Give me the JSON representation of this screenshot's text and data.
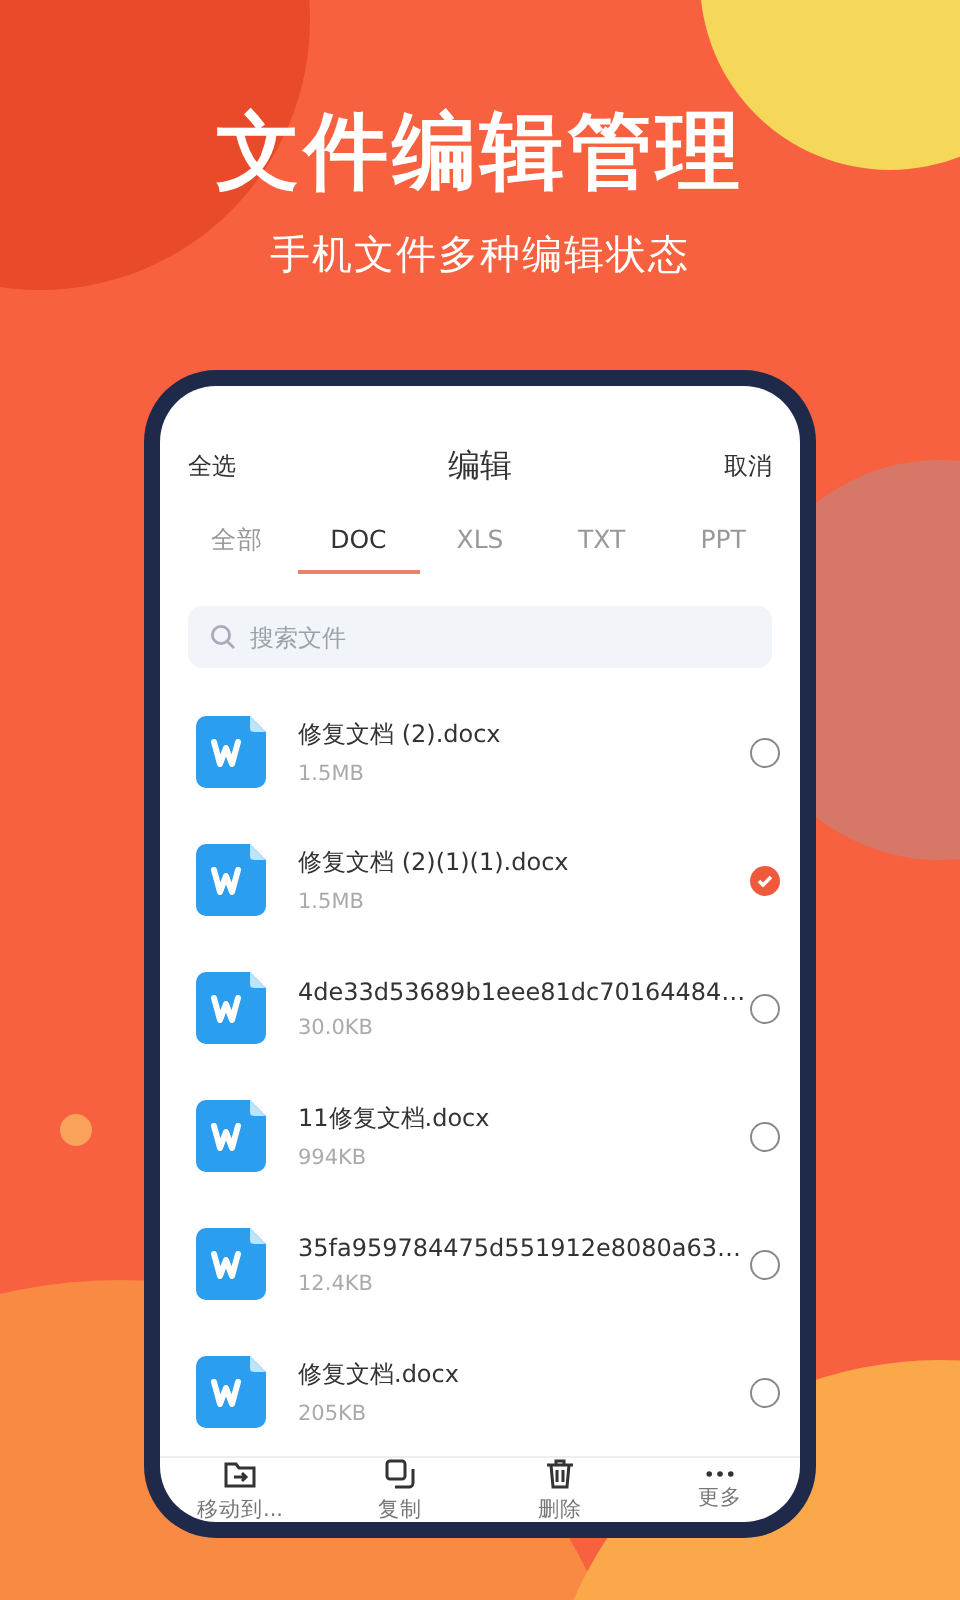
{
  "headline": "文件编辑管理",
  "subheadline": "手机文件多种编辑状态",
  "header": {
    "left": "全选",
    "title": "编辑",
    "right": "取消"
  },
  "tabs": [
    {
      "label": "全部",
      "selected": false
    },
    {
      "label": "DOC",
      "selected": true
    },
    {
      "label": "XLS",
      "selected": false
    },
    {
      "label": "TXT",
      "selected": false
    },
    {
      "label": "PPT",
      "selected": false
    }
  ],
  "search": {
    "placeholder": "搜索文件"
  },
  "files": [
    {
      "name": "修复文档 (2).docx",
      "size": "1.5MB",
      "selected": false
    },
    {
      "name": "修复文档 (2)(1)(1).docx",
      "size": "1.5MB",
      "selected": true
    },
    {
      "name": "4de33d53689b1eee81dc70164484…",
      "size": "30.0KB",
      "selected": false
    },
    {
      "name": "11修复文档.docx",
      "size": "994KB",
      "selected": false
    },
    {
      "name": "35fa959784475d551912e8080a63…",
      "size": "12.4KB",
      "selected": false
    },
    {
      "name": "修复文档.docx",
      "size": "205KB",
      "selected": false
    }
  ],
  "actions": [
    {
      "kind": "move",
      "label": "移动到..."
    },
    {
      "kind": "copy",
      "label": "复制"
    },
    {
      "kind": "delete",
      "label": "删除"
    },
    {
      "kind": "more",
      "label": "更多"
    }
  ]
}
